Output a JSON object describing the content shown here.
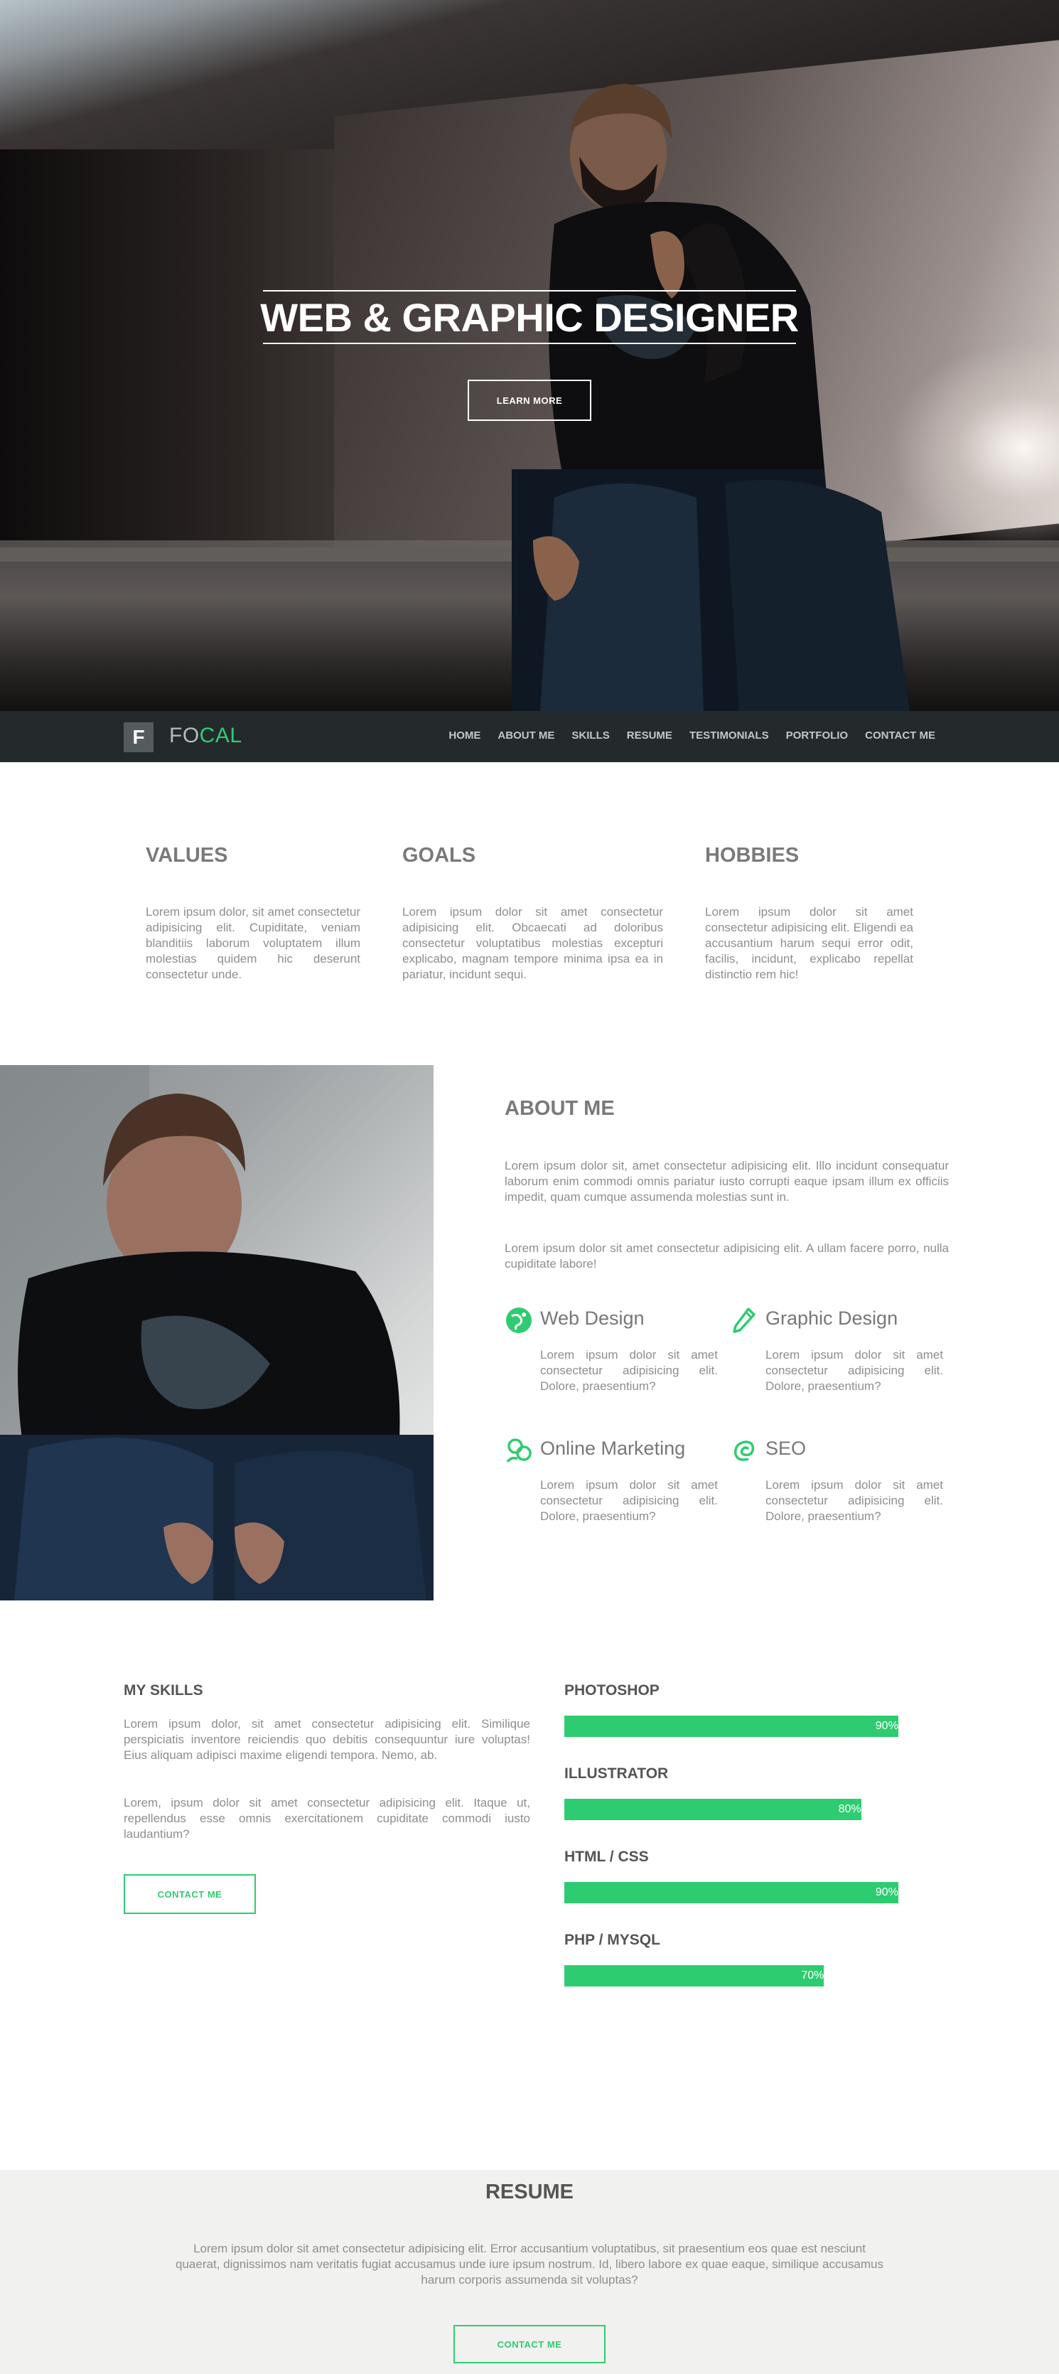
{
  "hero": {
    "title": "WEB & GRAPHIC DESIGNER",
    "button_label": "LEARN MORE"
  },
  "nav": {
    "logo_letter": "F",
    "logo_text_a": "FO",
    "logo_text_b": "CAL",
    "items": [
      "HOME",
      "ABOUT ME",
      "SKILLS",
      "RESUME",
      "TESTIMONIALS",
      "PORTFOLIO",
      "CONTACT ME"
    ]
  },
  "values": [
    {
      "title": "VALUES",
      "text": "Lorem ipsum dolor, sit amet consectetur adipisicing elit. Cupiditate, veniam blanditiis laborum voluptatem illum molestias quidem hic deserunt consectetur unde."
    },
    {
      "title": "GOALS",
      "text": "Lorem ipsum dolor sit amet consectetur adipisicing elit. Obcaecati ad doloribus consectetur voluptatibus molestias excepturi explicabo, magnam tempore minima ipsa ea in pariatur, incidunt sequi."
    },
    {
      "title": "HOBBIES",
      "text": "Lorem ipsum dolor sit amet consectetur adipisicing elit. Eligendi ea accusantium harum sequi error odit, facilis, incidunt, explicabo repellat distinctio rem hic!"
    }
  ],
  "about": {
    "title": "ABOUT ME",
    "p1": "Lorem ipsum dolor sit, amet consectetur adipisicing elit. Illo incidunt consequatur laborum enim commodi omnis pariatur iusto corrupti eaque ipsam illum ex officiis impedit, quam cumque assumenda molestias sunt in.",
    "p2": "Lorem ipsum dolor sit amet consectetur adipisicing elit. A ullam facere porro, nulla cupiditate labore!",
    "services": [
      {
        "title": "Web Design",
        "icon": "web-design-icon",
        "text": "Lorem ipsum dolor sit amet consectetur adipisicing elit. Dolore, praesentium?"
      },
      {
        "title": "Graphic Design",
        "icon": "pen-icon",
        "text": "Lorem ipsum dolor sit amet consectetur adipisicing elit. Dolore, praesentium?"
      },
      {
        "title": "Online Marketing",
        "icon": "people-icon",
        "text": "Lorem ipsum dolor sit amet consectetur adipisicing elit. Dolore, praesentium?"
      },
      {
        "title": "SEO",
        "icon": "seo-icon",
        "text": "Lorem ipsum dolor sit amet consectetur adipisicing elit. Dolore, praesentium?"
      }
    ]
  },
  "skills": {
    "title": "MY SKILLS",
    "p1": "Lorem ipsum dolor, sit amet consectetur adipisicing elit. Similique perspiciatis inventore reiciendis quo debitis consequuntur iure voluptas! Eius aliquam adipisci maxime eligendi tempora. Nemo, ab.",
    "p2": "Lorem, ipsum dolor sit amet consectetur adipisicing elit. Itaque ut, repellendus esse omnis exercitationem cupiditate commodi iusto laudantium?",
    "button_label": "CONTACT ME",
    "bars": [
      {
        "label": "PHOTOSHOP",
        "percent": 90,
        "percent_text": "90%"
      },
      {
        "label": "ILLUSTRATOR",
        "percent": 80,
        "percent_text": "80%"
      },
      {
        "label": "HTML / CSS",
        "percent": 90,
        "percent_text": "90%"
      },
      {
        "label": "PHP / MYSQL",
        "percent": 70,
        "percent_text": "70%"
      }
    ]
  },
  "resume": {
    "title": "RESUME",
    "text": "Lorem ipsum dolor sit amet consectetur adipisicing elit. Error accusantium voluptatibus, sit praesentium eos quae est nesciunt quaerat, dignissimos nam veritatis fugiat accusamus unde iure ipsum nostrum. Id, libero labore ex quae eaque, similique accusamus harum corporis assumenda sit voluptas?",
    "button_label": "CONTACT ME"
  },
  "colors": {
    "accent": "#2ecc71",
    "nav_bg": "#242a2c",
    "resume_bg": "#f1f1f0"
  }
}
